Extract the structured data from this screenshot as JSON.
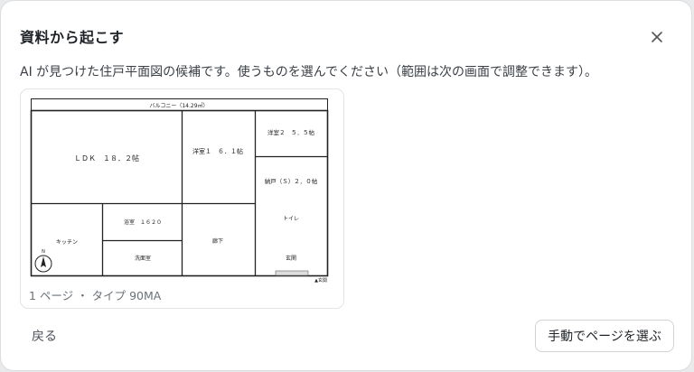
{
  "dialog": {
    "title": "資料から起こす",
    "description": "AI が見つけた住戸平面図の候補です。使うものを選んでください（範囲は次の画面で調整できます）。",
    "close_icon": "close-icon"
  },
  "candidate": {
    "caption": "1 ページ ・ タイプ 90MA",
    "plan": {
      "balcony": "バルコニー（14.29㎡）",
      "ldk": "ＬＤＫ　１８．２帖",
      "room1": "洋室１　６．１帖",
      "room2": "洋室２　５．５帖",
      "storage": "納戸（Ｓ）２．０帖",
      "kitchen": "キッチン",
      "bath": "浴室　１６２０",
      "washroom": "洗面室",
      "hallway": "廊下",
      "toilet": "トイレ",
      "entrance": "玄関",
      "entrance_mark": "▲玄関",
      "north": "N"
    }
  },
  "footer": {
    "back_label": "戻る",
    "manual_label": "手動でページを選ぶ"
  }
}
